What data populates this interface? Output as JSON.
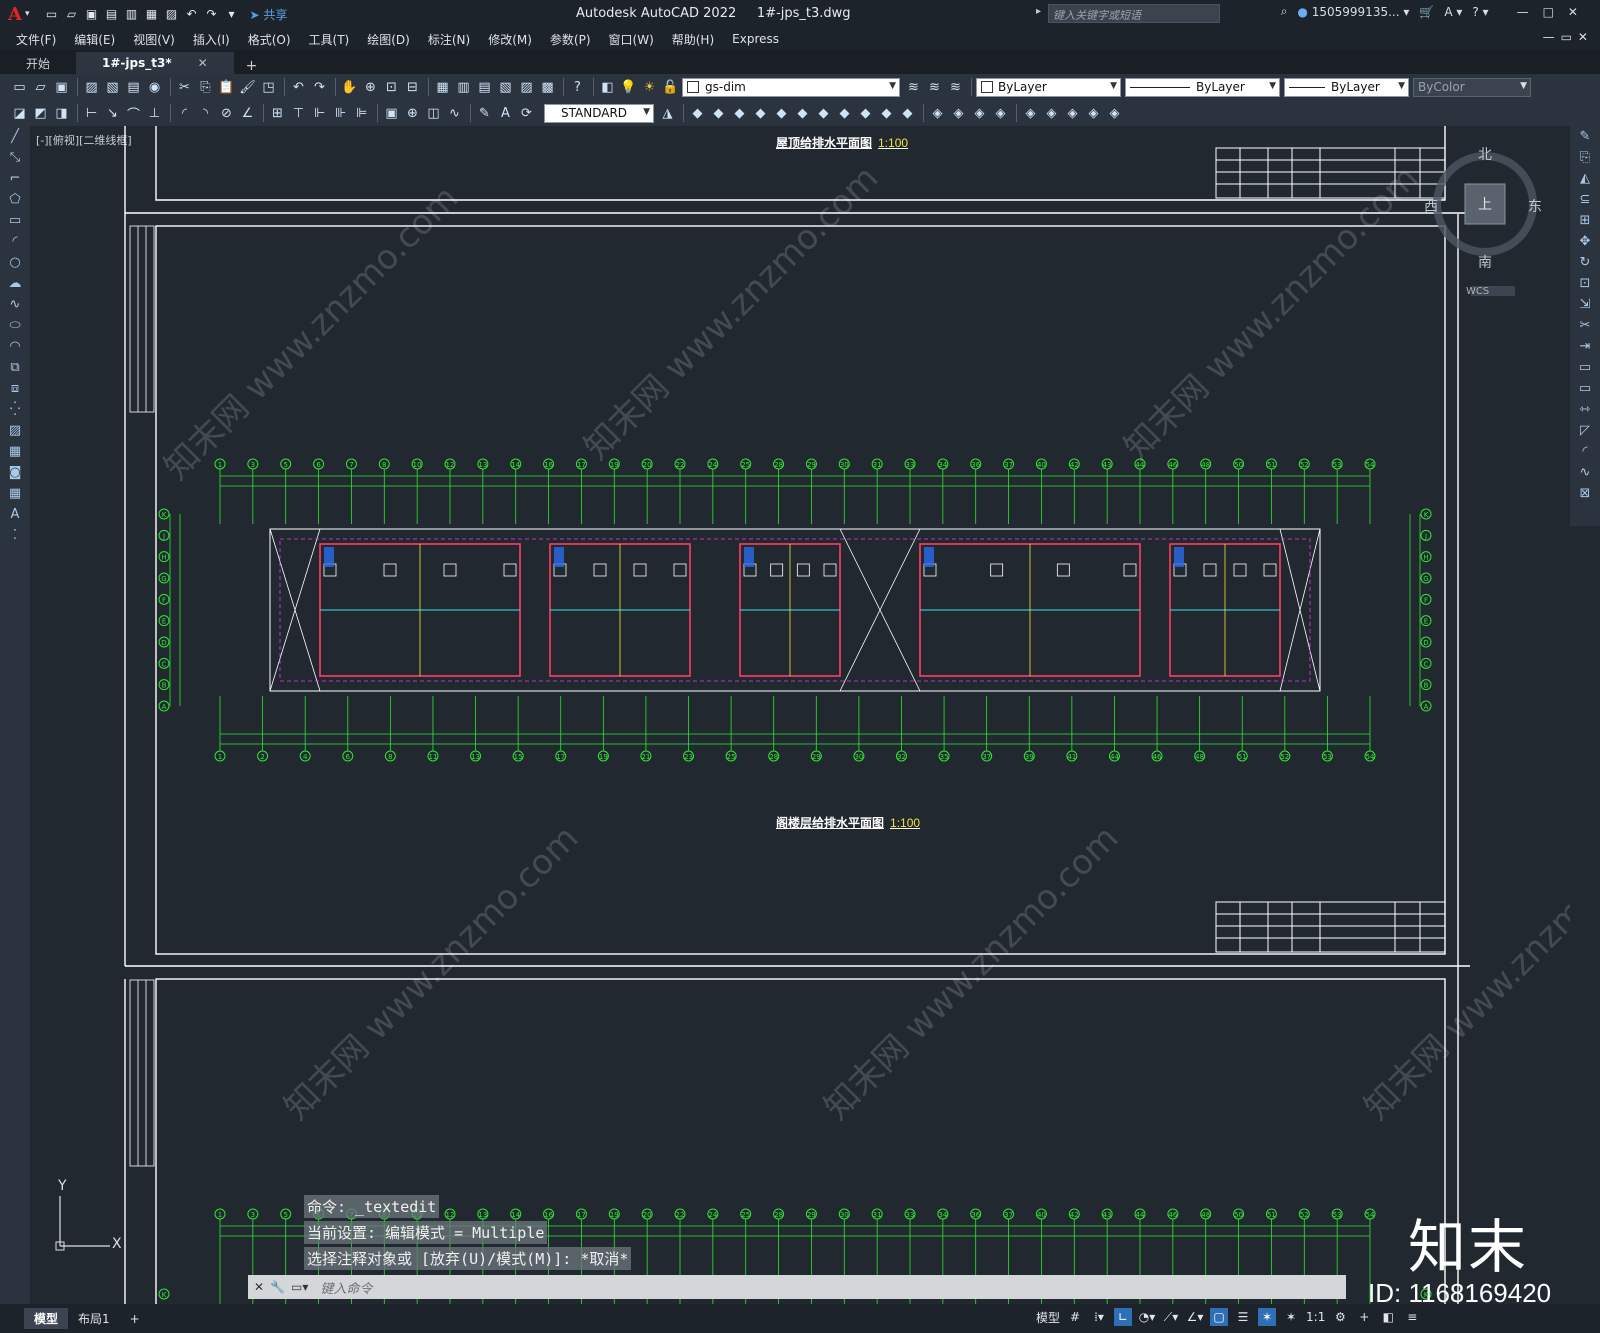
{
  "app": {
    "title": "Autodesk AutoCAD 2022",
    "file": "1#-jps_t3.dwg",
    "share_label": "共享",
    "search_placeholder": "键入关键字或短语",
    "user": "1505999135..."
  },
  "menu": [
    "文件(F)",
    "编辑(E)",
    "视图(V)",
    "插入(I)",
    "格式(O)",
    "工具(T)",
    "绘图(D)",
    "标注(N)",
    "修改(M)",
    "参数(P)",
    "窗口(W)",
    "帮助(H)",
    "Express"
  ],
  "tabs": {
    "start": "开始",
    "doc": "1#-jps_t3*"
  },
  "toolbar": {
    "layer": "gs-dim",
    "text_style": "STANDARD",
    "color": "ByLayer",
    "linetype": "ByLayer",
    "lineweight": "ByLayer",
    "plotstyle": "ByColor"
  },
  "viewport": {
    "label": "[-][俯视][二维线框]",
    "title_top": "屋顶给排水平面图",
    "title_top_scale": "1:100",
    "title_mid": "阁楼层给排水平面图",
    "title_mid_scale": "1:100",
    "compass": {
      "n": "北",
      "s": "南",
      "e": "东",
      "w": "西",
      "wcs": "WCS",
      "top": "上"
    },
    "ucs": {
      "x": "X",
      "y": "Y"
    },
    "axis_labels_top": [
      "1",
      "3",
      "5",
      "6",
      "7",
      "8",
      "10",
      "12",
      "13",
      "14",
      "16",
      "17",
      "19",
      "20",
      "22",
      "24",
      "25",
      "28",
      "29",
      "30",
      "31",
      "33",
      "34",
      "36",
      "37",
      "40",
      "42",
      "43",
      "44",
      "46",
      "48",
      "50",
      "51",
      "52",
      "53",
      "54"
    ],
    "axis_labels_bottom": [
      "1",
      "2",
      "4",
      "6",
      "8",
      "11",
      "13",
      "15",
      "17",
      "19",
      "21",
      "23",
      "25",
      "28",
      "29",
      "30",
      "32",
      "35",
      "37",
      "39",
      "41",
      "44",
      "46",
      "48",
      "51",
      "52",
      "53",
      "54"
    ],
    "row_labels": [
      "K",
      "J",
      "H",
      "G",
      "F",
      "E",
      "D",
      "C",
      "B",
      "A"
    ]
  },
  "command": {
    "history": [
      "命令: _textedit",
      "当前设置: 编辑模式 = Multiple",
      "选择注释对象或 [放弃(U)/模式(M)]: *取消*"
    ],
    "placeholder": "键入命令"
  },
  "status": {
    "tab_model": "模型",
    "tab_layout": "布局1",
    "model_btn": "模型",
    "scale": "1:1"
  },
  "watermark": {
    "brand": "知末",
    "id": "ID: 1168169420",
    "site_cn": "知末网",
    "site_url": "www.znzmo.com"
  },
  "colors": {
    "bg": "#212830",
    "grid_green": "#2ee82e",
    "wall_red": "#ff3c64",
    "pipe_cyan": "#33e6e6",
    "magenta": "#e63ce6",
    "yellow": "#f2e33a",
    "blue": "#2a6be8"
  }
}
